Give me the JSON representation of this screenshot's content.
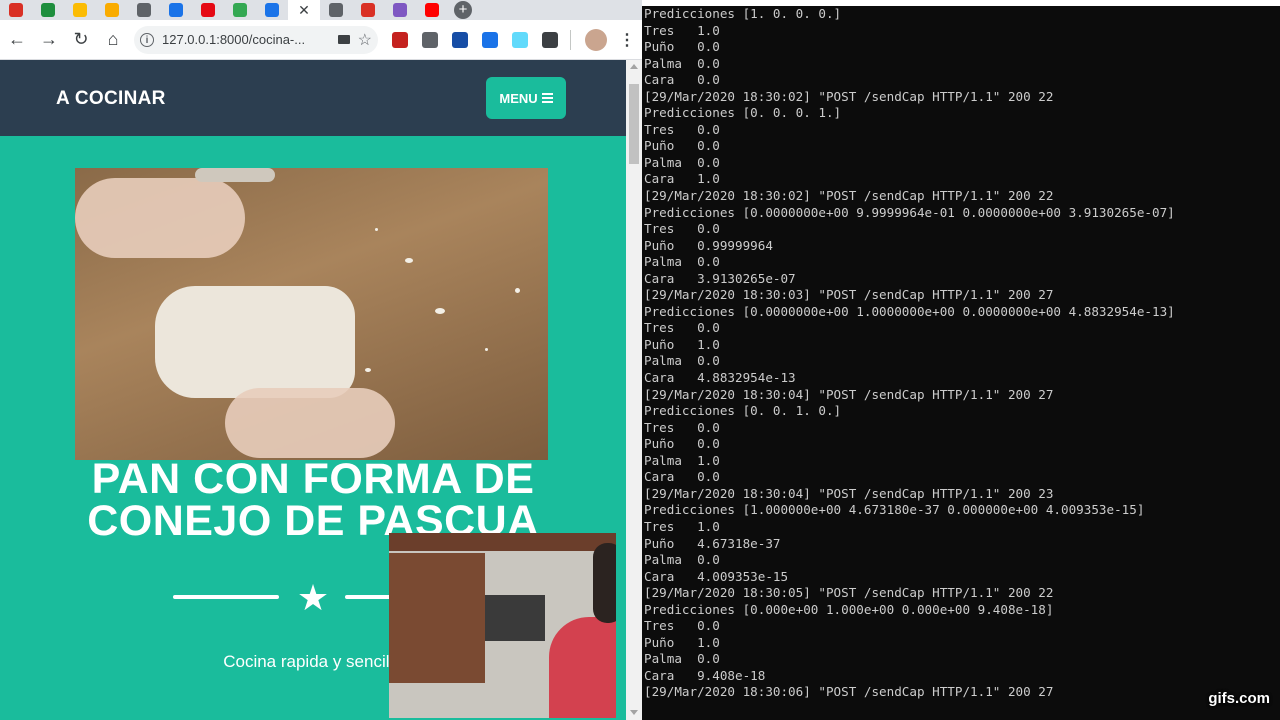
{
  "browser": {
    "tabs": [
      {
        "icon": "gmail-icon",
        "color": "#d93025"
      },
      {
        "icon": "drive-icon",
        "color": "#1e8e3e"
      },
      {
        "icon": "drive-icon",
        "color": "#fbbc04"
      },
      {
        "icon": "emoji-icon",
        "color": "#f9ab00"
      },
      {
        "icon": "globe-icon",
        "color": "#5f6368"
      },
      {
        "icon": "bookmark-icon",
        "color": "#1a73e8"
      },
      {
        "icon": "netflix-icon",
        "color": "#e50914"
      },
      {
        "icon": "app-icon",
        "color": "#34a853"
      },
      {
        "icon": "app-icon",
        "color": "#1a73e8"
      }
    ],
    "active_tab_close": "✕",
    "tabs_after": [
      {
        "icon": "globe-icon",
        "color": "#5f6368"
      },
      {
        "icon": "app-icon",
        "color": "#d93025"
      },
      {
        "icon": "app-icon",
        "color": "#7e57c2"
      },
      {
        "icon": "youtube-icon",
        "color": "#ff0000"
      }
    ],
    "new_tab": "+",
    "url": "127.0.0.1:8000/cocina-...",
    "extensions": [
      {
        "icon": "abp-icon",
        "color": "#c5221f"
      },
      {
        "icon": "cube-icon",
        "color": "#5f6368"
      },
      {
        "icon": "extension-icon",
        "color": "#174ea6"
      },
      {
        "icon": "extension-icon",
        "color": "#1a73e8"
      },
      {
        "icon": "react-icon",
        "color": "#61dafb"
      },
      {
        "icon": "playlist-icon",
        "color": "#3c4043"
      }
    ]
  },
  "site": {
    "brand": "A COCINAR",
    "menu_label": "MENU",
    "heading": "PAN CON FORMA DE CONEJO DE PASCUA",
    "subtitle": "Cocina rapida y sencilla"
  },
  "terminal": {
    "lines": [
      "Predicciones [1. 0. 0. 0.]",
      "Tres   1.0",
      "Puño   0.0",
      "Palma  0.0",
      "Cara   0.0",
      "[29/Mar/2020 18:30:02] \"POST /sendCap HTTP/1.1\" 200 22",
      "Predicciones [0. 0. 0. 1.]",
      "Tres   0.0",
      "Puño   0.0",
      "Palma  0.0",
      "Cara   1.0",
      "[29/Mar/2020 18:30:02] \"POST /sendCap HTTP/1.1\" 200 22",
      "Predicciones [0.0000000e+00 9.9999964e-01 0.0000000e+00 3.9130265e-07]",
      "Tres   0.0",
      "Puño   0.99999964",
      "Palma  0.0",
      "Cara   3.9130265e-07",
      "[29/Mar/2020 18:30:03] \"POST /sendCap HTTP/1.1\" 200 27",
      "Predicciones [0.0000000e+00 1.0000000e+00 0.0000000e+00 4.8832954e-13]",
      "Tres   0.0",
      "Puño   1.0",
      "Palma  0.0",
      "Cara   4.8832954e-13",
      "[29/Mar/2020 18:30:04] \"POST /sendCap HTTP/1.1\" 200 27",
      "Predicciones [0. 0. 1. 0.]",
      "Tres   0.0",
      "Puño   0.0",
      "Palma  1.0",
      "Cara   0.0",
      "[29/Mar/2020 18:30:04] \"POST /sendCap HTTP/1.1\" 200 23",
      "Predicciones [1.000000e+00 4.673180e-37 0.000000e+00 4.009353e-15]",
      "Tres   1.0",
      "Puño   4.67318e-37",
      "Palma  0.0",
      "Cara   4.009353e-15",
      "[29/Mar/2020 18:30:05] \"POST /sendCap HTTP/1.1\" 200 22",
      "Predicciones [0.000e+00 1.000e+00 0.000e+00 9.408e-18]",
      "Tres   0.0",
      "Puño   1.0",
      "Palma  0.0",
      "Cara   9.408e-18",
      "[29/Mar/2020 18:30:06] \"POST /sendCap HTTP/1.1\" 200 27"
    ]
  },
  "watermark": "gifs.com"
}
